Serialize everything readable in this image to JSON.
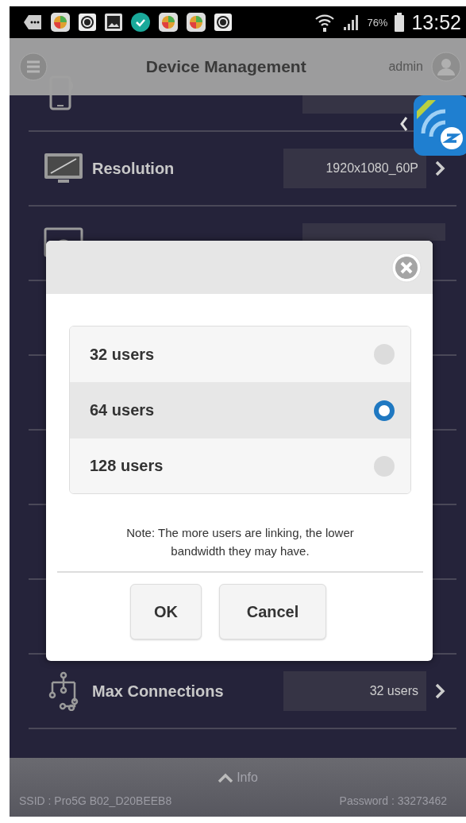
{
  "status_bar": {
    "battery": "76%",
    "time": "13:52"
  },
  "header": {
    "title": "Device Management",
    "user": "admin"
  },
  "settings": [
    {
      "label": "Resolution",
      "value": "1920x1080_60P"
    },
    {
      "label": "Max Connections",
      "value": "32 users"
    }
  ],
  "dialog": {
    "options": [
      {
        "label": "32 users",
        "selected": false
      },
      {
        "label": "64 users",
        "selected": true
      },
      {
        "label": "128 users",
        "selected": false
      }
    ],
    "note": "Note: The more users are linking, the lower bandwidth they may have.",
    "buttons": [
      "OK",
      "Cancel"
    ]
  },
  "footer": {
    "toggle": "Info",
    "ssid": "SSID : Pro5G B02_D20BEEB8",
    "password": "Password : 33273462"
  }
}
